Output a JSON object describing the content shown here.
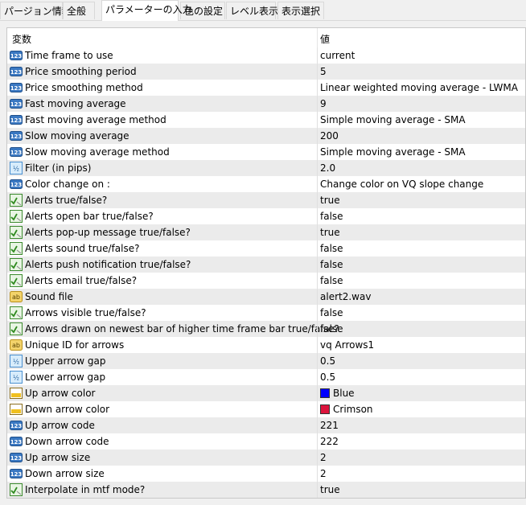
{
  "tabs": [
    "パージョン情報",
    "全般",
    "パラメーターの入力",
    "色の設定",
    "レベル表示",
    "表示選択"
  ],
  "table": {
    "col_variable": "変数",
    "col_value": "値",
    "rows": [
      {
        "icon": "int-123-icon",
        "name": "Time frame to use",
        "value": "current"
      },
      {
        "icon": "int-123-icon",
        "name": "Price smoothing period",
        "value": "5"
      },
      {
        "icon": "int-123-icon",
        "name": "Price smoothing method",
        "value": "Linear weighted moving average - LWMA"
      },
      {
        "icon": "int-123-icon",
        "name": "Fast moving average",
        "value": "9"
      },
      {
        "icon": "int-123-icon",
        "name": "Fast moving average method",
        "value": "Simple moving average - SMA"
      },
      {
        "icon": "int-123-icon",
        "name": "Slow moving average",
        "value": "200"
      },
      {
        "icon": "int-123-icon",
        "name": "Slow moving average method",
        "value": "Simple moving average - SMA"
      },
      {
        "icon": "double-half-icon",
        "name": "Filter (in pips)",
        "value": "2.0"
      },
      {
        "icon": "int-123-icon",
        "name": "Color change on :",
        "value": "Change color on VQ slope change"
      },
      {
        "icon": "bool-icon",
        "name": "Alerts true/false?",
        "value": "true"
      },
      {
        "icon": "bool-icon",
        "name": "Alerts open bar true/false?",
        "value": "false"
      },
      {
        "icon": "bool-icon",
        "name": "Alerts pop-up message true/false?",
        "value": "true"
      },
      {
        "icon": "bool-icon",
        "name": "Alerts sound true/false?",
        "value": "false"
      },
      {
        "icon": "bool-icon",
        "name": "Alerts push notification true/false?",
        "value": "false"
      },
      {
        "icon": "bool-icon",
        "name": "Alerts email true/false?",
        "value": "false"
      },
      {
        "icon": "string-ab-icon",
        "name": "Sound file",
        "value": "alert2.wav"
      },
      {
        "icon": "bool-icon",
        "name": "Arrows visible true/false?",
        "value": "false"
      },
      {
        "icon": "bool-icon",
        "name": "Arrows drawn on newest bar of higher time frame bar true/false?",
        "value": "false"
      },
      {
        "icon": "string-ab-icon",
        "name": "Unique ID for arrows",
        "value": "vq Arrows1"
      },
      {
        "icon": "double-half-icon",
        "name": "Upper arrow gap",
        "value": "0.5"
      },
      {
        "icon": "double-half-icon",
        "name": "Lower arrow gap",
        "value": "0.5"
      },
      {
        "icon": "color-icon",
        "name": "Up arrow color",
        "value": "Blue",
        "swatch": "#0000ff"
      },
      {
        "icon": "color-icon",
        "name": "Down arrow color",
        "value": "Crimson",
        "swatch": "#dc143c"
      },
      {
        "icon": "int-123-icon",
        "name": "Up arrow code",
        "value": "221"
      },
      {
        "icon": "int-123-icon",
        "name": "Down arrow code",
        "value": "222"
      },
      {
        "icon": "int-123-icon",
        "name": "Up arrow size",
        "value": "2"
      },
      {
        "icon": "int-123-icon",
        "name": "Down arrow size",
        "value": "2"
      },
      {
        "icon": "bool-icon",
        "name": "Interpolate in mtf mode?",
        "value": "true"
      }
    ]
  }
}
